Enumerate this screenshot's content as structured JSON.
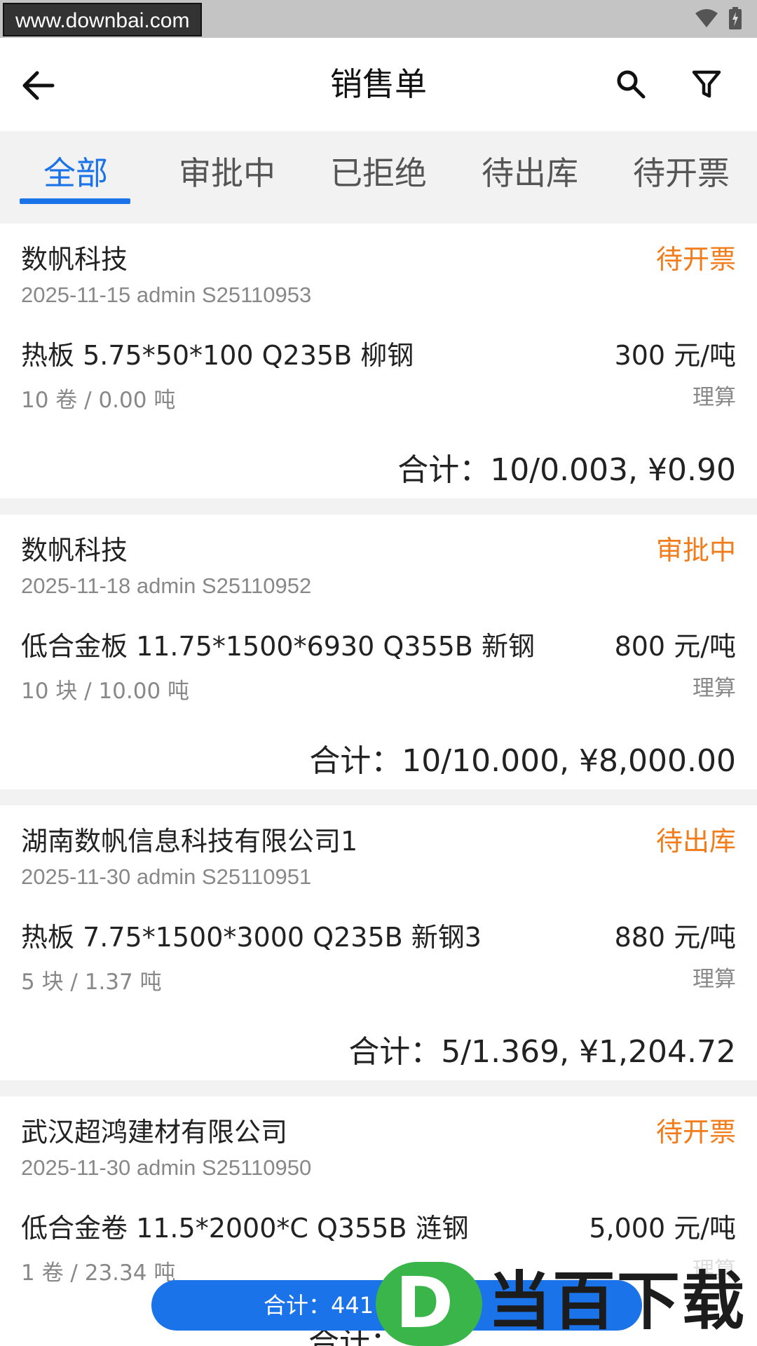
{
  "status_bar": {
    "watermark": "www.downbai.com"
  },
  "header": {
    "title": "销售单"
  },
  "tabs": [
    {
      "label": "全部",
      "active": true
    },
    {
      "label": "审批中",
      "active": false
    },
    {
      "label": "已拒绝",
      "active": false
    },
    {
      "label": "待出库",
      "active": false
    },
    {
      "label": "待开票",
      "active": false
    }
  ],
  "orders": [
    {
      "customer": "数帆科技",
      "status": "待开票",
      "meta": "2025-11-15 admin S25110953",
      "product": "热板 5.75*50*100 Q235B 柳钢",
      "price": "300 元/吨",
      "qty": "10 卷 / 0.00 吨",
      "calc": "理算",
      "total": "合计：10/0.003, ¥0.90"
    },
    {
      "customer": "数帆科技",
      "status": "审批中",
      "meta": "2025-11-18 admin S25110952",
      "product": "低合金板 11.75*1500*6930 Q355B 新钢",
      "price": "800 元/吨",
      "qty": "10 块 / 10.00 吨",
      "calc": "理算",
      "total": "合计：10/10.000, ¥8,000.00"
    },
    {
      "customer": "湖南数帆信息科技有限公司1",
      "status": "待出库",
      "meta": "2025-11-30 admin S25110951",
      "product": "热板 7.75*1500*3000 Q235B 新钢3",
      "price": "880 元/吨",
      "qty": "5 块 / 1.37 吨",
      "calc": "理算",
      "total": "合计：5/1.369, ¥1,204.72"
    },
    {
      "customer": "武汉超鸿建材有限公司",
      "status": "待开票",
      "meta": "2025-11-30 admin S25110950",
      "product": "低合金卷 11.5*2000*C Q355B 涟钢",
      "price": "5,000 元/吨",
      "qty": "1 卷 / 23.34 吨",
      "calc": "理算",
      "total": "合计："
    }
  ],
  "summary": {
    "text": "合计：441"
  },
  "logo": {
    "letter": "D",
    "text": "当百下载"
  },
  "colors": {
    "accent": "#1a73e8",
    "status": "#f27b1a",
    "logo_green": "#3ab54a"
  }
}
